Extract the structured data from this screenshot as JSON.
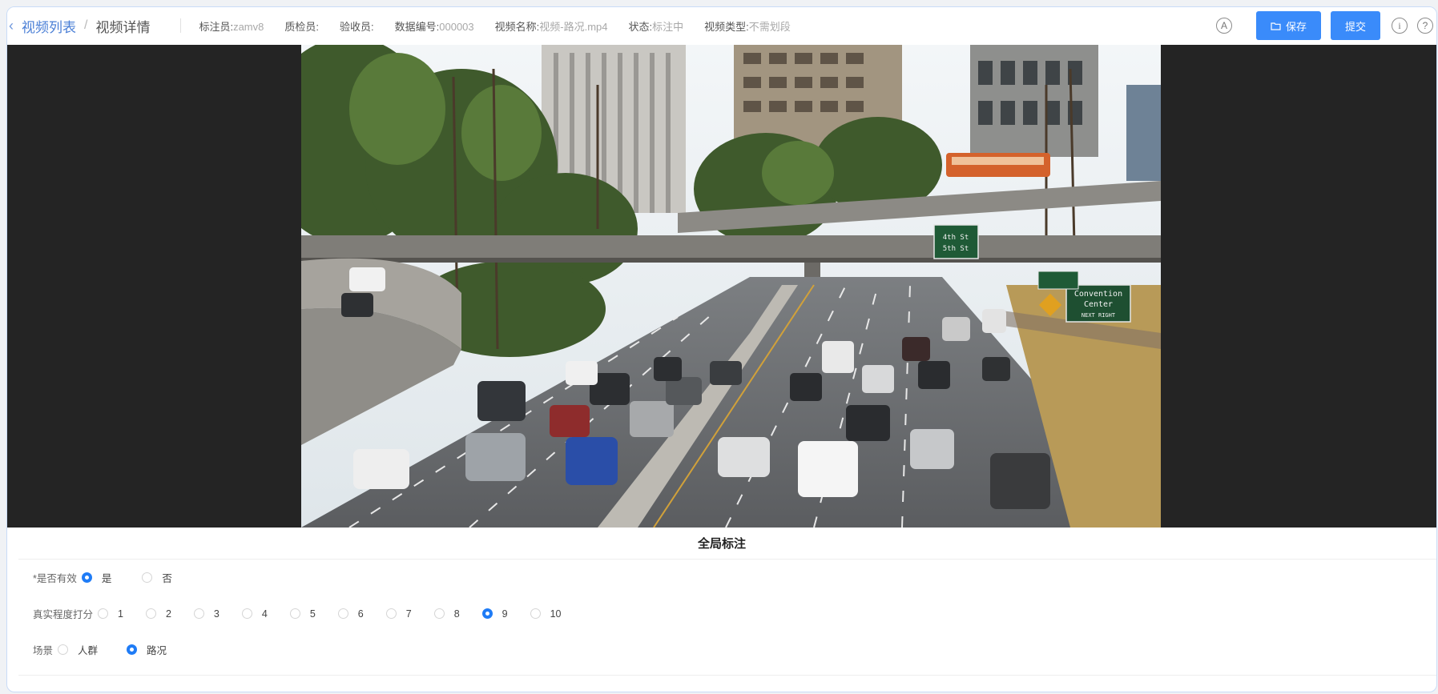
{
  "header": {
    "back_label": "视频列表",
    "separator": "/",
    "current": "视频详情",
    "meta": [
      {
        "key": "标注员:",
        "value": "zamv8"
      },
      {
        "key": "质检员:",
        "value": ""
      },
      {
        "key": "验收员:",
        "value": ""
      },
      {
        "key": "数据编号:",
        "value": "000003"
      },
      {
        "key": "视频名称:",
        "value": "视频-路况.mp4"
      },
      {
        "key": "状态:",
        "value": "标注中"
      },
      {
        "key": "视频类型:",
        "value": "不需划段"
      }
    ],
    "a_icon_glyph": "A",
    "save_label": "保存",
    "submit_label": "提交",
    "info_glyph": "i",
    "help_glyph": "?"
  },
  "video": {
    "signs": {
      "street_top": "4th St",
      "street_bottom": "5th St",
      "convention_line1": "Convention",
      "convention_line2": "Center",
      "convention_line3": "NEXT RIGHT"
    }
  },
  "form": {
    "section_title": "全局标注",
    "valid": {
      "label": "*是否有效",
      "options": [
        "是",
        "否"
      ],
      "selected": "是"
    },
    "realism": {
      "label": "真实程度打分",
      "options": [
        "1",
        "2",
        "3",
        "4",
        "5",
        "6",
        "7",
        "8",
        "9",
        "10"
      ],
      "selected": "9"
    },
    "scene": {
      "label": "场景",
      "options": [
        "人群",
        "路况"
      ],
      "selected": "路况"
    }
  },
  "colors": {
    "primary": "#3a8bfa",
    "link": "#4a7fd6",
    "video_bg": "#242424"
  }
}
